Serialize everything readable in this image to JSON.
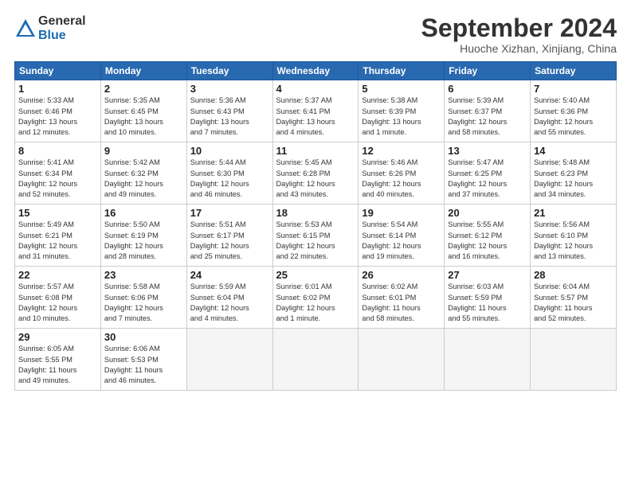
{
  "logo": {
    "general": "General",
    "blue": "Blue"
  },
  "title": "September 2024",
  "subtitle": "Huoche Xizhan, Xinjiang, China",
  "headers": [
    "Sunday",
    "Monday",
    "Tuesday",
    "Wednesday",
    "Thursday",
    "Friday",
    "Saturday"
  ],
  "days": [
    {
      "num": "",
      "info": ""
    },
    {
      "num": "",
      "info": ""
    },
    {
      "num": "",
      "info": ""
    },
    {
      "num": "",
      "info": ""
    },
    {
      "num": "",
      "info": ""
    },
    {
      "num": "",
      "info": ""
    },
    {
      "num": "1",
      "info": "Sunrise: 5:33 AM\nSunset: 6:46 PM\nDaylight: 13 hours\nand 12 minutes."
    },
    {
      "num": "2",
      "info": "Sunrise: 5:35 AM\nSunset: 6:45 PM\nDaylight: 13 hours\nand 10 minutes."
    },
    {
      "num": "3",
      "info": "Sunrise: 5:36 AM\nSunset: 6:43 PM\nDaylight: 13 hours\nand 7 minutes."
    },
    {
      "num": "4",
      "info": "Sunrise: 5:37 AM\nSunset: 6:41 PM\nDaylight: 13 hours\nand 4 minutes."
    },
    {
      "num": "5",
      "info": "Sunrise: 5:38 AM\nSunset: 6:39 PM\nDaylight: 13 hours\nand 1 minute."
    },
    {
      "num": "6",
      "info": "Sunrise: 5:39 AM\nSunset: 6:37 PM\nDaylight: 12 hours\nand 58 minutes."
    },
    {
      "num": "7",
      "info": "Sunrise: 5:40 AM\nSunset: 6:36 PM\nDaylight: 12 hours\nand 55 minutes."
    },
    {
      "num": "8",
      "info": "Sunrise: 5:41 AM\nSunset: 6:34 PM\nDaylight: 12 hours\nand 52 minutes."
    },
    {
      "num": "9",
      "info": "Sunrise: 5:42 AM\nSunset: 6:32 PM\nDaylight: 12 hours\nand 49 minutes."
    },
    {
      "num": "10",
      "info": "Sunrise: 5:44 AM\nSunset: 6:30 PM\nDaylight: 12 hours\nand 46 minutes."
    },
    {
      "num": "11",
      "info": "Sunrise: 5:45 AM\nSunset: 6:28 PM\nDaylight: 12 hours\nand 43 minutes."
    },
    {
      "num": "12",
      "info": "Sunrise: 5:46 AM\nSunset: 6:26 PM\nDaylight: 12 hours\nand 40 minutes."
    },
    {
      "num": "13",
      "info": "Sunrise: 5:47 AM\nSunset: 6:25 PM\nDaylight: 12 hours\nand 37 minutes."
    },
    {
      "num": "14",
      "info": "Sunrise: 5:48 AM\nSunset: 6:23 PM\nDaylight: 12 hours\nand 34 minutes."
    },
    {
      "num": "15",
      "info": "Sunrise: 5:49 AM\nSunset: 6:21 PM\nDaylight: 12 hours\nand 31 minutes."
    },
    {
      "num": "16",
      "info": "Sunrise: 5:50 AM\nSunset: 6:19 PM\nDaylight: 12 hours\nand 28 minutes."
    },
    {
      "num": "17",
      "info": "Sunrise: 5:51 AM\nSunset: 6:17 PM\nDaylight: 12 hours\nand 25 minutes."
    },
    {
      "num": "18",
      "info": "Sunrise: 5:53 AM\nSunset: 6:15 PM\nDaylight: 12 hours\nand 22 minutes."
    },
    {
      "num": "19",
      "info": "Sunrise: 5:54 AM\nSunset: 6:14 PM\nDaylight: 12 hours\nand 19 minutes."
    },
    {
      "num": "20",
      "info": "Sunrise: 5:55 AM\nSunset: 6:12 PM\nDaylight: 12 hours\nand 16 minutes."
    },
    {
      "num": "21",
      "info": "Sunrise: 5:56 AM\nSunset: 6:10 PM\nDaylight: 12 hours\nand 13 minutes."
    },
    {
      "num": "22",
      "info": "Sunrise: 5:57 AM\nSunset: 6:08 PM\nDaylight: 12 hours\nand 10 minutes."
    },
    {
      "num": "23",
      "info": "Sunrise: 5:58 AM\nSunset: 6:06 PM\nDaylight: 12 hours\nand 7 minutes."
    },
    {
      "num": "24",
      "info": "Sunrise: 5:59 AM\nSunset: 6:04 PM\nDaylight: 12 hours\nand 4 minutes."
    },
    {
      "num": "25",
      "info": "Sunrise: 6:01 AM\nSunset: 6:02 PM\nDaylight: 12 hours\nand 1 minute."
    },
    {
      "num": "26",
      "info": "Sunrise: 6:02 AM\nSunset: 6:01 PM\nDaylight: 11 hours\nand 58 minutes."
    },
    {
      "num": "27",
      "info": "Sunrise: 6:03 AM\nSunset: 5:59 PM\nDaylight: 11 hours\nand 55 minutes."
    },
    {
      "num": "28",
      "info": "Sunrise: 6:04 AM\nSunset: 5:57 PM\nDaylight: 11 hours\nand 52 minutes."
    },
    {
      "num": "29",
      "info": "Sunrise: 6:05 AM\nSunset: 5:55 PM\nDaylight: 11 hours\nand 49 minutes."
    },
    {
      "num": "30",
      "info": "Sunrise: 6:06 AM\nSunset: 5:53 PM\nDaylight: 11 hours\nand 46 minutes."
    },
    {
      "num": "",
      "info": ""
    },
    {
      "num": "",
      "info": ""
    },
    {
      "num": "",
      "info": ""
    },
    {
      "num": "",
      "info": ""
    },
    {
      "num": "",
      "info": ""
    }
  ]
}
